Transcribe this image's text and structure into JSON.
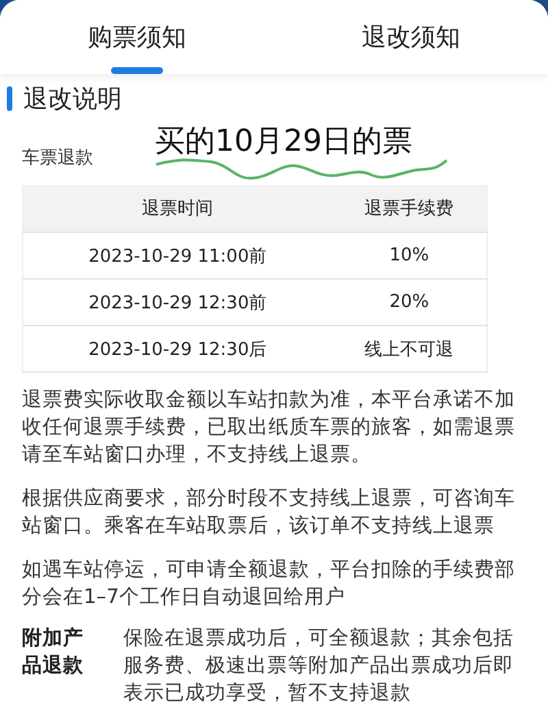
{
  "tabs": [
    {
      "label": "购票须知",
      "selected": true
    },
    {
      "label": "退改须知",
      "selected": false
    }
  ],
  "section_title": "退改说明",
  "ticket_refund": {
    "label": "车票退款",
    "annotation": "买的10月29日的票",
    "table": {
      "columns": [
        "退票时间",
        "退票手续费"
      ],
      "rows": [
        [
          "2023-10-29 11:00前",
          "10%"
        ],
        [
          "2023-10-29 12:30前",
          "20%"
        ],
        [
          "2023-10-29 12:30后",
          "线上不可退"
        ]
      ]
    }
  },
  "notes": [
    "退票费实际收取金额以车站扣款为准，本平台承诺不加收任何退票手续费，已取出纸质车票的旅客，如需退票请至车站窗口办理，不支持线上退票。",
    "根据供应商要求，部分时段不支持线上退票，可咨询车站窗口。乘客在车站取票后，该订单不支持线上退票",
    "如遇车站停运，可申请全额退款，平台扣除的手续费部分会在1–7个工作日自动退回给用户"
  ],
  "addon": {
    "label": "附加产品退款",
    "text": "保险在退票成功后，可全额退款；其余包括服务费、极速出票等附加产品出票成功后即表示已成功享受，暂不支持退款"
  }
}
